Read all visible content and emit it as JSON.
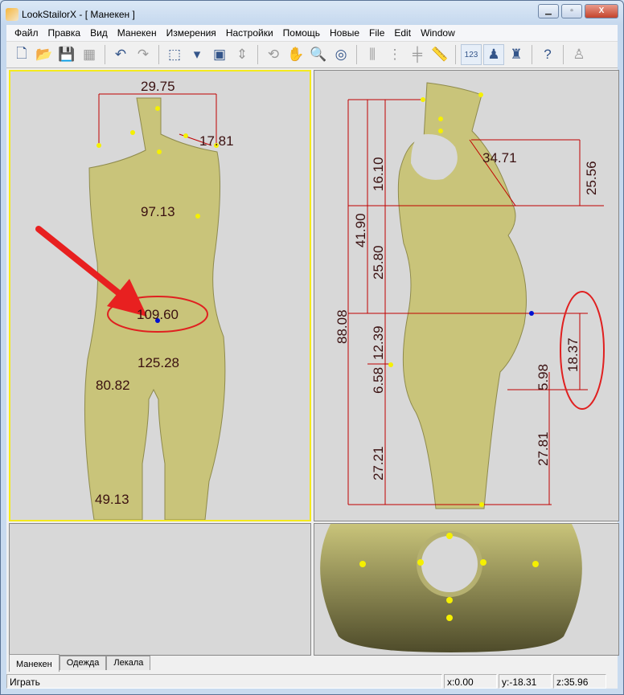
{
  "window": {
    "title": "LookStailorX - [ Манекен    ]",
    "minimize": "▁",
    "maximize": "▫",
    "close": "X"
  },
  "menu": [
    "Файл",
    "Правка",
    "Вид",
    "Манекен",
    "Измерения",
    "Настройки",
    "Помощь",
    "Новые",
    "File",
    "Edit",
    "Window"
  ],
  "toolbar": [
    {
      "icon": "new-file-icon",
      "glyph": "🗋"
    },
    {
      "icon": "open-folder-icon",
      "glyph": "📂"
    },
    {
      "icon": "save-icon",
      "glyph": "💾",
      "disabled": true
    },
    {
      "icon": "save-all-icon",
      "glyph": "▦",
      "disabled": true
    },
    {
      "icon": "undo-icon",
      "glyph": "↶"
    },
    {
      "icon": "redo-icon",
      "glyph": "↷",
      "disabled": true
    },
    {
      "icon": "view-cube-icon",
      "glyph": "⬚"
    },
    {
      "icon": "dropdown-arrow-icon",
      "glyph": "▾"
    },
    {
      "icon": "layout-icon",
      "glyph": "▣"
    },
    {
      "icon": "fit-height-icon",
      "glyph": "⇕",
      "disabled": true
    },
    {
      "icon": "rotate-icon",
      "glyph": "⟲",
      "disabled": true
    },
    {
      "icon": "pan-hand-icon",
      "glyph": "✋"
    },
    {
      "icon": "zoom-icon",
      "glyph": "🔍"
    },
    {
      "icon": "orbit-icon",
      "glyph": "◎"
    },
    {
      "icon": "measure-vertical-icon",
      "glyph": "⫼",
      "disabled": true
    },
    {
      "icon": "measure-dotted-icon",
      "glyph": "⋮",
      "disabled": true
    },
    {
      "icon": "measure-cross-icon",
      "glyph": "╪",
      "disabled": true
    },
    {
      "icon": "ruler-icon",
      "glyph": "📏",
      "disabled": true
    },
    {
      "icon": "show-values-icon",
      "glyph": "123",
      "active": true
    },
    {
      "icon": "mannequin-points-icon",
      "glyph": "♟",
      "active": true
    },
    {
      "icon": "add-mannequin-icon",
      "glyph": "♜"
    },
    {
      "icon": "help-icon",
      "glyph": "?"
    },
    {
      "icon": "mannequin-gray-icon",
      "glyph": "♙",
      "disabled": true
    }
  ],
  "front": {
    "neck": "29.75",
    "shoulder": "17.81",
    "chest": "97.13",
    "waist": "109.60",
    "hips": "125.28",
    "thigh": "80.82",
    "knee": "49.13"
  },
  "side": {
    "v1": "88.08",
    "v2": "41.90",
    "v3": "16.10",
    "v4": "25.80",
    "v5": "12.39",
    "v6": "6.58",
    "v7": "27.21",
    "v8": "34.71",
    "v9": "25.56",
    "v10": "18.37",
    "v11": "5.98",
    "v12": "27.81"
  },
  "tabs": [
    "Манекен",
    "Одежда",
    "Лекала"
  ],
  "status": {
    "text": "Играть",
    "x": "x:0.00",
    "y": "y:-18.31",
    "z": "z:35.96"
  },
  "colors": {
    "body": "#c9c47a",
    "dim": "#c00000",
    "annot": "#e02020"
  }
}
